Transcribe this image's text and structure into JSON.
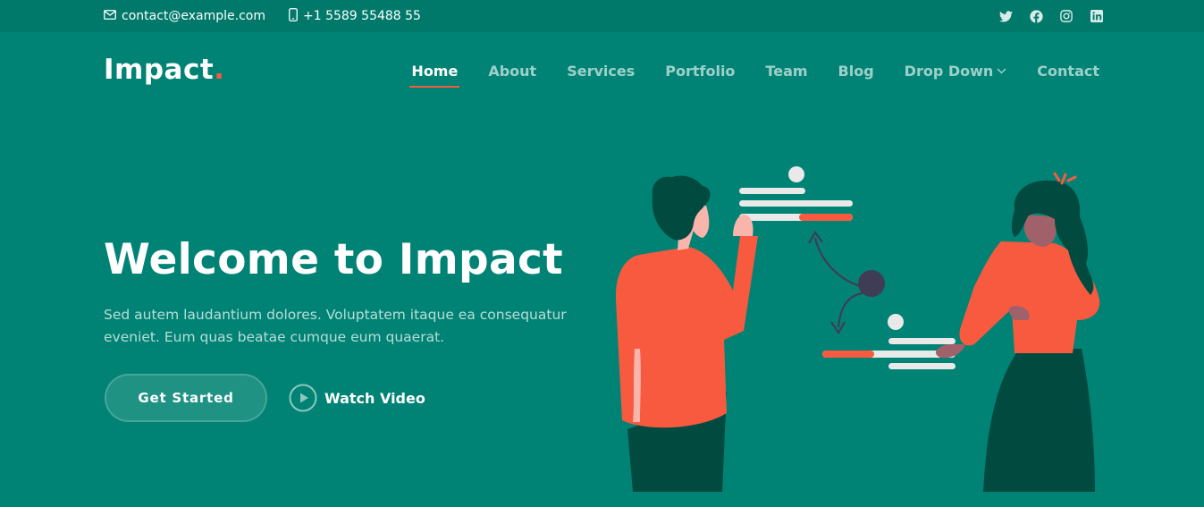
{
  "topbar": {
    "email": "contact@example.com",
    "phone": "+1 5589 55488 55",
    "social": [
      "twitter-icon",
      "facebook-icon",
      "instagram-icon",
      "linkedin-icon"
    ]
  },
  "header": {
    "logo": "Impact",
    "logo_dot": ".",
    "nav": [
      {
        "label": "Home",
        "active": true
      },
      {
        "label": "About"
      },
      {
        "label": "Services"
      },
      {
        "label": "Portfolio"
      },
      {
        "label": "Team"
      },
      {
        "label": "Blog"
      },
      {
        "label": "Drop Down"
      },
      {
        "label": "Contact"
      }
    ]
  },
  "hero": {
    "title": "Welcome to Impact",
    "text": "Sed autem laudantium dolores. Voluptatem itaque ea consequatur eveniet. Eum quas beatae cumque eum quaerat.",
    "cta_label": "Get Started",
    "video_label": "Watch Video"
  },
  "colors": {
    "background": "#008374",
    "topbar": "#00796b",
    "accent": "#f85a40",
    "dark_green": "#004a40"
  }
}
